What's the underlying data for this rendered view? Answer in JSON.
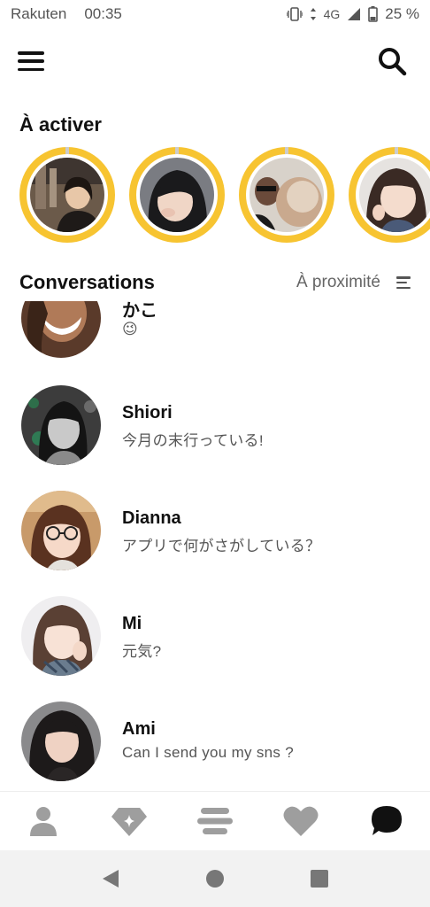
{
  "status_bar": {
    "carrier": "Rakuten",
    "time": "00:35",
    "network": "4G",
    "battery": "25 %"
  },
  "header": {
    "menu_icon": "hamburger-menu-icon",
    "search_icon": "search-icon"
  },
  "queue": {
    "title": "À activer",
    "ring_color": "#f7c431"
  },
  "conversations": {
    "title": "Conversations",
    "sort_label": "À proximité",
    "items": [
      {
        "name": "かこ",
        "message": "😉"
      },
      {
        "name": "Shiori",
        "message": "今月の末行っている!"
      },
      {
        "name": "Dianna",
        "message": "アプリで何がさがしている？"
      },
      {
        "name": "Mi",
        "message": "元気?"
      },
      {
        "name": "Ami",
        "message": "Can I send you my sns ?"
      }
    ]
  },
  "bottom_nav": {
    "items": [
      "profile-icon",
      "beeline-icon",
      "people-icon",
      "heart-icon",
      "chat-icon"
    ],
    "active": "chat-icon"
  },
  "android_nav": [
    "back-icon",
    "home-icon",
    "recents-icon"
  ],
  "colors": {
    "accent": "#f7c431",
    "text": "#111111",
    "muted": "#666666",
    "nav_inactive": "#9e9e9e"
  }
}
